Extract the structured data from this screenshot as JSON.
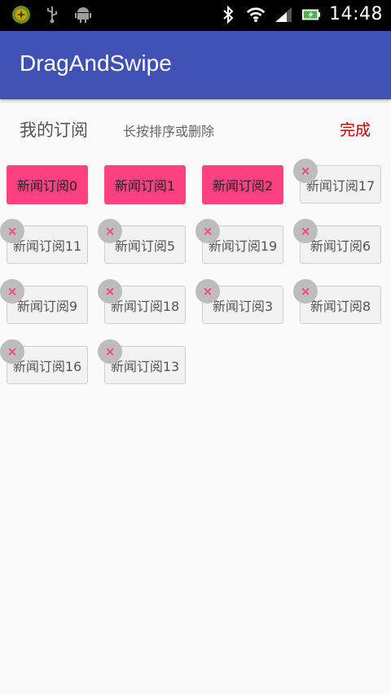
{
  "status_bar": {
    "time": "14:48",
    "left_icons": [
      "app-badge-icon",
      "usb-icon",
      "android-icon"
    ],
    "right_icons": [
      "bluetooth-icon",
      "wifi-icon",
      "signal-icon",
      "battery-charging-icon"
    ]
  },
  "app_bar": {
    "title": "DragAndSwipe",
    "color": "#3f51b5"
  },
  "header": {
    "title": "我的订阅",
    "hint": "长按排序或删除",
    "done": "完成"
  },
  "accent": "#ff4081",
  "delete_symbol": "×",
  "channels": [
    {
      "label": "新闻订阅0",
      "selected": true,
      "deletable": false
    },
    {
      "label": "新闻订阅1",
      "selected": true,
      "deletable": false
    },
    {
      "label": "新闻订阅2",
      "selected": true,
      "deletable": false
    },
    {
      "label": "新闻订阅17",
      "selected": false,
      "deletable": true
    },
    {
      "label": "新闻订阅11",
      "selected": false,
      "deletable": true
    },
    {
      "label": "新闻订阅5",
      "selected": false,
      "deletable": true
    },
    {
      "label": "新闻订阅19",
      "selected": false,
      "deletable": true
    },
    {
      "label": "新闻订阅6",
      "selected": false,
      "deletable": true
    },
    {
      "label": "新闻订阅9",
      "selected": false,
      "deletable": true
    },
    {
      "label": "新闻订阅18",
      "selected": false,
      "deletable": true
    },
    {
      "label": "新闻订阅3",
      "selected": false,
      "deletable": true
    },
    {
      "label": "新闻订阅8",
      "selected": false,
      "deletable": true
    },
    {
      "label": "新闻订阅16",
      "selected": false,
      "deletable": true
    },
    {
      "label": "新闻订阅13",
      "selected": false,
      "deletable": true
    }
  ]
}
